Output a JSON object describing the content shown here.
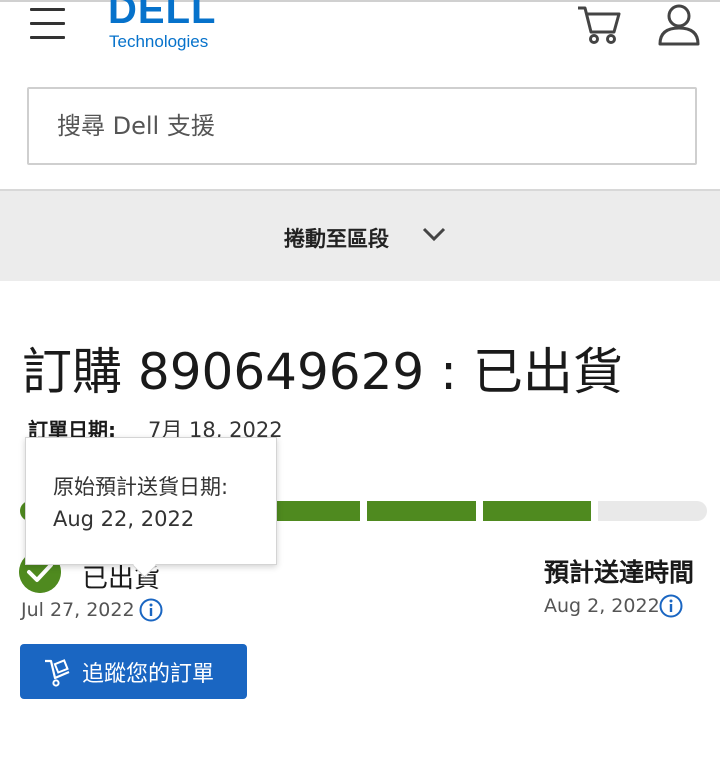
{
  "header": {
    "brand": "DELL",
    "brand_sub": "Technologies"
  },
  "search": {
    "placeholder": "搜尋 Dell 支援"
  },
  "section_nav": {
    "label": "捲動至區段"
  },
  "order": {
    "title": "訂購 890649629 : 已出貨",
    "date_label": "訂單日期:",
    "date_value": "7月 18, 2022"
  },
  "progress": {
    "filled_segments": 5,
    "total_segments": 6
  },
  "status": {
    "label": "已出貨",
    "date": "Jul 27, 2022"
  },
  "eta": {
    "label": "預計送達時間",
    "date": "Aug 2, 2022"
  },
  "tooltip": {
    "line1": "原始預計送貨日期:",
    "line2": "Aug 22, 2022"
  },
  "track_button": {
    "label": "追蹤您的訂單"
  },
  "colors": {
    "brand_blue": "#0672cb",
    "progress_green": "#4f8a1f",
    "button_blue": "#1a66c2"
  },
  "icons": [
    "menu-icon",
    "cart-icon",
    "user-icon",
    "chevron-down-icon",
    "check-icon",
    "info-icon",
    "truck-icon"
  ]
}
